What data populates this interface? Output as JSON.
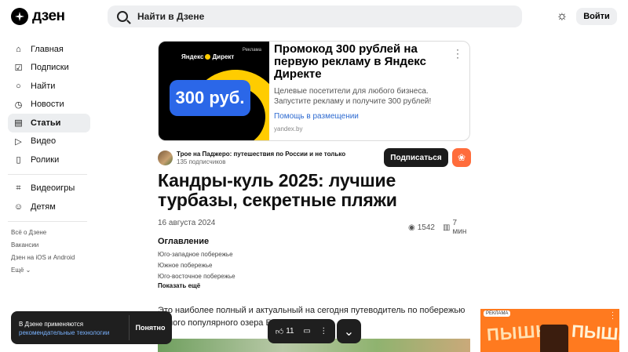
{
  "header": {
    "logo_text": "дзен",
    "search_placeholder": "Найти в Дзене",
    "login_label": "Войти",
    "theme_icon": "sun-icon"
  },
  "sidebar": {
    "items": [
      {
        "label": "Главная",
        "icon": "home-icon",
        "glyph": "⌂"
      },
      {
        "label": "Подписки",
        "icon": "subscriptions-icon",
        "glyph": "☑"
      },
      {
        "label": "Найти",
        "icon": "search-icon",
        "glyph": "○"
      },
      {
        "label": "Новости",
        "icon": "news-icon",
        "glyph": "◷"
      },
      {
        "label": "Статьи",
        "icon": "articles-icon",
        "glyph": "▤"
      },
      {
        "label": "Видео",
        "icon": "video-icon",
        "glyph": "▷"
      },
      {
        "label": "Ролики",
        "icon": "shorts-icon",
        "glyph": "▯"
      }
    ],
    "items2": [
      {
        "label": "Видеоигры",
        "icon": "gamepad-icon",
        "glyph": "⌗"
      },
      {
        "label": "Детям",
        "icon": "kids-icon",
        "glyph": "☺"
      }
    ],
    "footer_links": [
      "Всё о Дзене",
      "Вакансии",
      "Дзен на iOS и Android",
      "Ещё"
    ],
    "active_index": 4
  },
  "ad": {
    "image_tag": "Реклама",
    "image_brand_1": "Яндекс",
    "image_brand_2": "Директ",
    "image_price": "300 руб.",
    "title": "Промокод 300 рублей на первую рекламу в Яндекс Директе",
    "description": "Целевые посетители для любого бизнеса. Запустите рекламу и получите 300 рублей!",
    "link": "Помощь в размещении",
    "domain": "yandex.by"
  },
  "channel": {
    "name": "Трое на Паджеро: путешествия по России и не только",
    "subscribers": "135 подписчиков",
    "subscribe_label": "Подписаться"
  },
  "article": {
    "title": "Кандры-куль 2025: лучшие турбазы, секретные пляжи",
    "date": "16 августа 2024",
    "views": "1542",
    "read_time": "7 мин",
    "toc_title": "Оглавление",
    "toc_items": [
      "Юго-западное побережье",
      "Южное побережье",
      "Юго-восточное побережье"
    ],
    "toc_more": "Показать ещё",
    "intro": "Это наиболее полный и актуальный на сегодня путеводитель по побережью самого популярного озера Башкирии."
  },
  "side_ad": {
    "tag": "РЕКЛАМА",
    "word_left": "ПЫШК",
    "word_right": "ПЫШК"
  },
  "cookie_toast": {
    "text": "В Дзене применяются",
    "link": "рекомендательные технологии",
    "ok_label": "Понятно"
  },
  "action_bar": {
    "likes": "11"
  }
}
